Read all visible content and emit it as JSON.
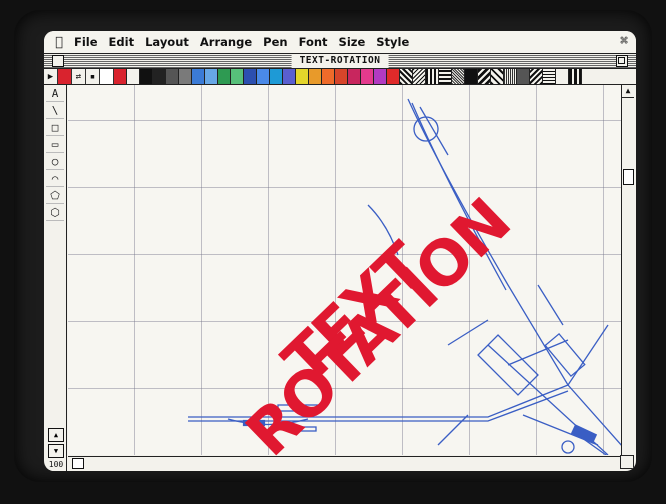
{
  "menubar": {
    "apple": "",
    "items": [
      "File",
      "Edit",
      "Layout",
      "Arrange",
      "Pen",
      "Font",
      "Size",
      "Style"
    ]
  },
  "window": {
    "title": "TEXT-ROTATION"
  },
  "toolbox": {
    "tools": [
      "A",
      "\\",
      "□",
      "▭",
      "○",
      "⌒",
      "⬠",
      "⬡"
    ],
    "zoom_level": "100"
  },
  "canvas": {
    "headline_lines": [
      "TEXT",
      "ROTATION"
    ],
    "headline_color": "#e01830"
  },
  "palette": {
    "colors": [
      "#d9232e",
      "#f3f2ec",
      "#111111",
      "#222222",
      "#555555",
      "#7a7a7a",
      "#3b7bd6",
      "#67a7e6",
      "#2e9a52",
      "#57c07a",
      "#2c4fb0",
      "#4a89e8",
      "#1e9ad6",
      "#5a5fd0",
      "#e4d52b",
      "#e89a2a",
      "#ef6b2a",
      "#d7452a",
      "#c8265e",
      "#e43a8d",
      "#b23ac2",
      "#e02a2a"
    ]
  }
}
